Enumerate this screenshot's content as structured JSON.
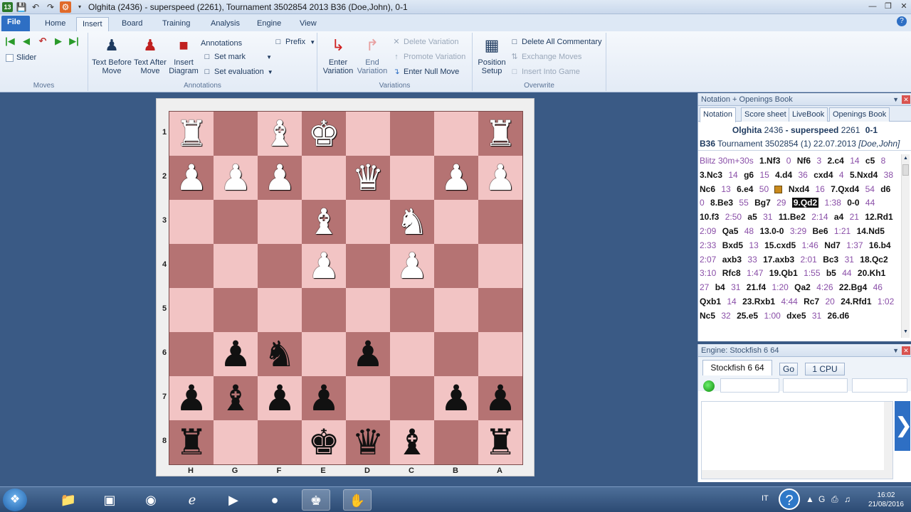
{
  "window": {
    "title": "Olghita (2436) - superspeed (2261), Tournament 3502854 2013  B36  (Doe,John), 0-1"
  },
  "tabs": {
    "file": "File",
    "items": [
      "Home",
      "Insert",
      "Board",
      "Training",
      "Analysis",
      "Engine",
      "View"
    ],
    "active": "Insert"
  },
  "ribbon": {
    "moves": {
      "slider": "Slider",
      "group": "Moves"
    },
    "annotations": {
      "text_before": "Text Before Move",
      "text_after": "Text After Move",
      "insert_diagram": "Insert Diagram",
      "annotations": "Annotations",
      "set_mark": "Set mark",
      "set_evaluation": "Set evaluation",
      "prefix": "Prefix",
      "group": "Annotations"
    },
    "variations": {
      "enter_variation": "Enter Variation",
      "end_variation": "End Variation",
      "delete_variation": "Delete Variation",
      "promote_variation": "Promote Variation",
      "enter_null_move": "Enter Null Move",
      "group": "Variations"
    },
    "overwrite": {
      "position_setup": "Position Setup",
      "delete_all_commentary": "Delete All Commentary",
      "exchange_moves": "Exchange Moves",
      "insert_into_game": "Insert Into Game",
      "group": "Overwrite"
    }
  },
  "board": {
    "ranks": [
      "1",
      "2",
      "3",
      "4",
      "5",
      "6",
      "7",
      "8"
    ],
    "files": [
      "H",
      "G",
      "F",
      "E",
      "D",
      "C",
      "B",
      "A"
    ],
    "pieces": [
      {
        "row": 0,
        "col": 0,
        "piece": "R",
        "color": "w"
      },
      {
        "row": 0,
        "col": 2,
        "piece": "B",
        "color": "w"
      },
      {
        "row": 0,
        "col": 3,
        "piece": "K",
        "color": "w"
      },
      {
        "row": 0,
        "col": 7,
        "piece": "R",
        "color": "w"
      },
      {
        "row": 1,
        "col": 0,
        "piece": "P",
        "color": "w"
      },
      {
        "row": 1,
        "col": 1,
        "piece": "P",
        "color": "w"
      },
      {
        "row": 1,
        "col": 2,
        "piece": "P",
        "color": "w"
      },
      {
        "row": 1,
        "col": 4,
        "piece": "Q",
        "color": "w"
      },
      {
        "row": 1,
        "col": 6,
        "piece": "P",
        "color": "w"
      },
      {
        "row": 1,
        "col": 7,
        "piece": "P",
        "color": "w"
      },
      {
        "row": 2,
        "col": 3,
        "piece": "B",
        "color": "w"
      },
      {
        "row": 2,
        "col": 5,
        "piece": "N",
        "color": "w"
      },
      {
        "row": 3,
        "col": 3,
        "piece": "P",
        "color": "w"
      },
      {
        "row": 3,
        "col": 5,
        "piece": "P",
        "color": "w"
      },
      {
        "row": 5,
        "col": 1,
        "piece": "P",
        "color": "b"
      },
      {
        "row": 5,
        "col": 2,
        "piece": "N",
        "color": "b"
      },
      {
        "row": 5,
        "col": 4,
        "piece": "P",
        "color": "b"
      },
      {
        "row": 6,
        "col": 0,
        "piece": "P",
        "color": "b"
      },
      {
        "row": 6,
        "col": 1,
        "piece": "B",
        "color": "b"
      },
      {
        "row": 6,
        "col": 2,
        "piece": "P",
        "color": "b"
      },
      {
        "row": 6,
        "col": 3,
        "piece": "P",
        "color": "b"
      },
      {
        "row": 6,
        "col": 6,
        "piece": "P",
        "color": "b"
      },
      {
        "row": 6,
        "col": 7,
        "piece": "P",
        "color": "b"
      },
      {
        "row": 7,
        "col": 0,
        "piece": "R",
        "color": "b"
      },
      {
        "row": 7,
        "col": 3,
        "piece": "K",
        "color": "b"
      },
      {
        "row": 7,
        "col": 4,
        "piece": "Q",
        "color": "b"
      },
      {
        "row": 7,
        "col": 5,
        "piece": "B",
        "color": "b"
      },
      {
        "row": 7,
        "col": 7,
        "piece": "R",
        "color": "b"
      }
    ],
    "light_color": "#f2c4c4",
    "dark_color": "#b57373"
  },
  "notation": {
    "panel_title": "Notation + Openings Book",
    "tabs": [
      "Notation",
      "Score sheet",
      "LiveBook",
      "Openings Book"
    ],
    "header": {
      "white": "Olghita",
      "white_elo": "2436",
      "sep": "-",
      "black": "superspeed",
      "black_elo": "2261",
      "result": "0-1",
      "eco": "B36",
      "event": "Tournament 3502854 (1) 22.07.2013",
      "annotator": "[Doe,John]"
    },
    "moves": [
      {
        "t": "tc",
        "v": "Blitz 30m+30s"
      },
      {
        "t": "mv",
        "v": "1.Nf3"
      },
      {
        "t": "tm",
        "v": "0"
      },
      {
        "t": "mv",
        "v": "Nf6"
      },
      {
        "t": "tm",
        "v": "3"
      },
      {
        "t": "mv",
        "v": "2.c4"
      },
      {
        "t": "tm",
        "v": "14"
      },
      {
        "t": "mv",
        "v": "c5"
      },
      {
        "t": "tm",
        "v": "8"
      },
      {
        "t": "mv",
        "v": "3.Nc3"
      },
      {
        "t": "tm",
        "v": "14"
      },
      {
        "t": "mv",
        "v": "g6"
      },
      {
        "t": "tm",
        "v": "15"
      },
      {
        "t": "mv",
        "v": "4.d4"
      },
      {
        "t": "tm",
        "v": "36"
      },
      {
        "t": "mv",
        "v": "cxd4"
      },
      {
        "t": "tm",
        "v": "4"
      },
      {
        "t": "mv",
        "v": "5.Nxd4"
      },
      {
        "t": "tm",
        "v": "38"
      },
      {
        "t": "mv",
        "v": "Nc6"
      },
      {
        "t": "tm",
        "v": "13"
      },
      {
        "t": "mv",
        "v": "6.e4"
      },
      {
        "t": "tm",
        "v": "50"
      },
      {
        "t": "ev",
        "v": ""
      },
      {
        "t": "mv",
        "v": "Nxd4"
      },
      {
        "t": "tm",
        "v": "16"
      },
      {
        "t": "mv",
        "v": "7.Qxd4"
      },
      {
        "t": "tm",
        "v": "54"
      },
      {
        "t": "mv",
        "v": "d6"
      },
      {
        "t": "tm",
        "v": "0"
      },
      {
        "t": "mv",
        "v": "8.Be3"
      },
      {
        "t": "tm",
        "v": "55"
      },
      {
        "t": "mv",
        "v": "Bg7"
      },
      {
        "t": "tm",
        "v": "29"
      },
      {
        "t": "cur",
        "v": "9.Qd2"
      },
      {
        "t": "tm",
        "v": "1:38"
      },
      {
        "t": "mv",
        "v": "0-0"
      },
      {
        "t": "tm",
        "v": "44"
      },
      {
        "t": "mv",
        "v": "10.f3"
      },
      {
        "t": "tm",
        "v": "2:50"
      },
      {
        "t": "mv",
        "v": "a5"
      },
      {
        "t": "tm",
        "v": "31"
      },
      {
        "t": "mv",
        "v": "11.Be2"
      },
      {
        "t": "tm",
        "v": "2:14"
      },
      {
        "t": "mv",
        "v": "a4"
      },
      {
        "t": "tm",
        "v": "21"
      },
      {
        "t": "mv",
        "v": "12.Rd1"
      },
      {
        "t": "tm",
        "v": "2:09"
      },
      {
        "t": "mv",
        "v": "Qa5"
      },
      {
        "t": "tm",
        "v": "48"
      },
      {
        "t": "mv",
        "v": "13.0-0"
      },
      {
        "t": "tm",
        "v": "3:29"
      },
      {
        "t": "mv",
        "v": "Be6"
      },
      {
        "t": "tm",
        "v": "1:21"
      },
      {
        "t": "mv",
        "v": "14.Nd5"
      },
      {
        "t": "tm",
        "v": "2:33"
      },
      {
        "t": "mv",
        "v": "Bxd5"
      },
      {
        "t": "tm",
        "v": "13"
      },
      {
        "t": "mv",
        "v": "15.cxd5"
      },
      {
        "t": "tm",
        "v": "1:46"
      },
      {
        "t": "mv",
        "v": "Nd7"
      },
      {
        "t": "tm",
        "v": "1:37"
      },
      {
        "t": "mv",
        "v": "16.b4"
      },
      {
        "t": "tm",
        "v": "2:07"
      },
      {
        "t": "mv",
        "v": "axb3"
      },
      {
        "t": "tm",
        "v": "33"
      },
      {
        "t": "mv",
        "v": "17.axb3"
      },
      {
        "t": "tm",
        "v": "2:01"
      },
      {
        "t": "mv",
        "v": "Bc3"
      },
      {
        "t": "tm",
        "v": "31"
      },
      {
        "t": "mv",
        "v": "18.Qc2"
      },
      {
        "t": "tm",
        "v": "3:10"
      },
      {
        "t": "mv",
        "v": "Rfc8"
      },
      {
        "t": "tm",
        "v": "1:47"
      },
      {
        "t": "mv",
        "v": "19.Qb1"
      },
      {
        "t": "tm",
        "v": "1:55"
      },
      {
        "t": "mv",
        "v": "b5"
      },
      {
        "t": "tm",
        "v": "44"
      },
      {
        "t": "mv",
        "v": "20.Kh1"
      },
      {
        "t": "tm",
        "v": "27"
      },
      {
        "t": "mv",
        "v": "b4"
      },
      {
        "t": "tm",
        "v": "31"
      },
      {
        "t": "mv",
        "v": "21.f4"
      },
      {
        "t": "tm",
        "v": "1:20"
      },
      {
        "t": "mv",
        "v": "Qa2"
      },
      {
        "t": "tm",
        "v": "4:26"
      },
      {
        "t": "mv",
        "v": "22.Bg4"
      },
      {
        "t": "tm",
        "v": "46"
      },
      {
        "t": "mv",
        "v": "Qxb1"
      },
      {
        "t": "tm",
        "v": "14"
      },
      {
        "t": "mv",
        "v": "23.Rxb1"
      },
      {
        "t": "tm",
        "v": "4:44"
      },
      {
        "t": "mv",
        "v": "Rc7"
      },
      {
        "t": "tm",
        "v": "20"
      },
      {
        "t": "mv",
        "v": "24.Rfd1"
      },
      {
        "t": "tm",
        "v": "1:02"
      },
      {
        "t": "mv",
        "v": "Nc5"
      },
      {
        "t": "tm",
        "v": "32"
      },
      {
        "t": "mv",
        "v": "25.e5"
      },
      {
        "t": "tm",
        "v": "1:00"
      },
      {
        "t": "mv",
        "v": "dxe5"
      },
      {
        "t": "tm",
        "v": "31"
      },
      {
        "t": "mv",
        "v": "26.d6"
      }
    ]
  },
  "engine": {
    "panel_title": "Engine: Stockfish 6 64",
    "name_tab": "Stockfish 6 64",
    "go": "Go",
    "cpu": "1 CPU"
  },
  "taskbar": {
    "lang": "IT",
    "time": "16:02",
    "date": "21/08/2016"
  }
}
